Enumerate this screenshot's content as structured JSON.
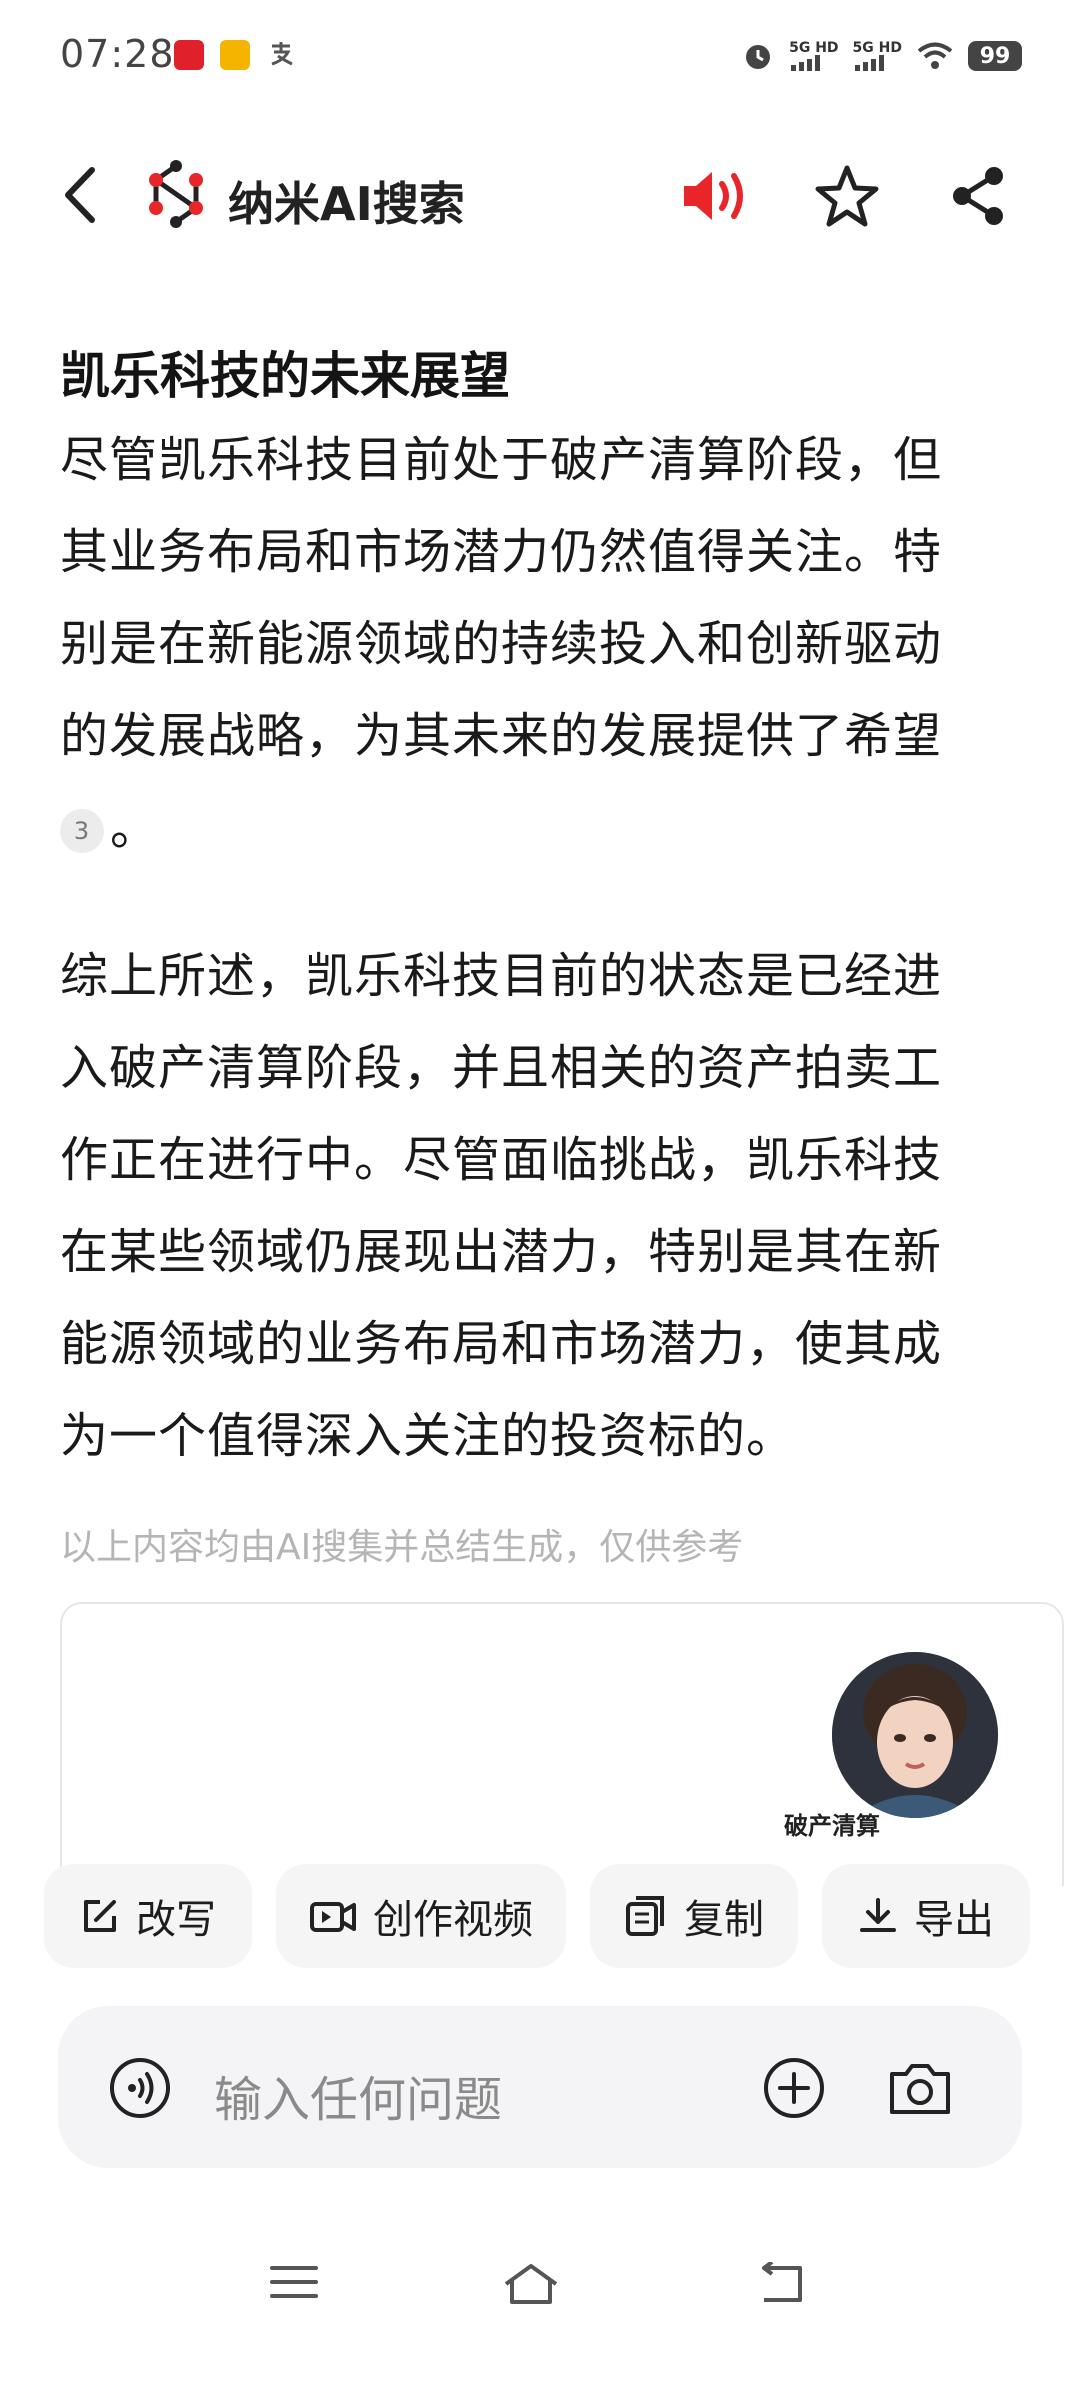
{
  "status_bar": {
    "time": "07:28",
    "signal_1": "5G HD",
    "signal_2": "5G HD",
    "battery": "99"
  },
  "header": {
    "title": "纳米AI搜索"
  },
  "content": {
    "section_title": "凯乐科技的未来展望",
    "paragraph_1": "尽管凯乐科技目前处于破产清算阶段，但其业务布局和市场潜力仍然值得关注。特别是在新能源领域的持续投入和创新驱动的发展战略，为其未来的发展提供了希望",
    "citation": "3",
    "paragraph_1_end": "。",
    "paragraph_2": "综上所述，凯乐科技目前的状态是已经进入破产清算阶段，并且相关的资产拍卖工作正在进行中。尽管面临挑战，凯乐科技在某些领域仍展现出潜力，特别是其在新能源领域的业务布局和市场潜力，使其成为一个值得深入关注的投资标的。",
    "disclaimer": "以上内容均由AI搜集并总结生成，仅供参考",
    "card_caption": "破产清算"
  },
  "actions": [
    {
      "label": "改写",
      "icon": "edit-icon"
    },
    {
      "label": "创作视频",
      "icon": "video-icon"
    },
    {
      "label": "复制",
      "icon": "copy-icon"
    },
    {
      "label": "导出",
      "icon": "download-icon"
    }
  ],
  "input": {
    "placeholder": "输入任何问题"
  },
  "colors": {
    "brand_red": "#e8262a",
    "text_primary": "#141414",
    "text_muted": "#b5b5b5",
    "button_bg": "#f5f5f6"
  }
}
